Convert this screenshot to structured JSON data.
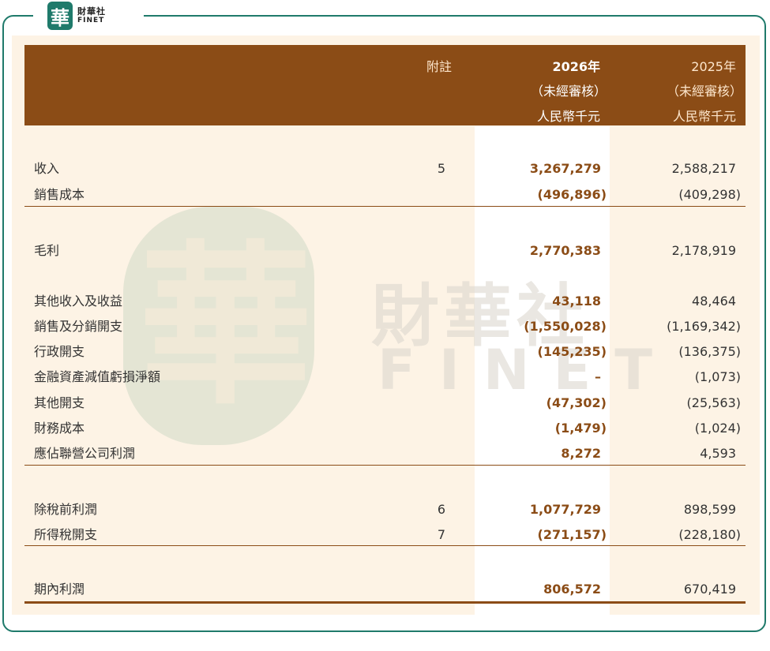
{
  "brand": {
    "name_cn": "財華社",
    "name_en": "FINET",
    "seal_char": "華"
  },
  "header": {
    "note_label": "附註",
    "current": {
      "year": "2026年",
      "audit": "（未經審核）",
      "unit": "人民幣千元"
    },
    "previous": {
      "year": "2025年",
      "audit": "（未經審核）",
      "unit": "人民幣千元"
    }
  },
  "rows": [
    {
      "label": "收入",
      "note": "5",
      "current": "3,267,279",
      "previous": "2,588,217"
    },
    {
      "label": "銷售成本",
      "note": "",
      "current": "(496,896)",
      "previous": "(409,298)"
    },
    {
      "label": "毛利",
      "note": "",
      "current": "2,770,383",
      "previous": "2,178,919"
    },
    {
      "label": "其他收入及收益",
      "note": "",
      "current": "43,118",
      "previous": "48,464"
    },
    {
      "label": "銷售及分銷開支",
      "note": "",
      "current": "(1,550,028)",
      "previous": "(1,169,342)"
    },
    {
      "label": "行政開支",
      "note": "",
      "current": "(145,235)",
      "previous": "(136,375)"
    },
    {
      "label": "金融資產減值虧損淨額",
      "note": "",
      "current": "–",
      "previous": "(1,073)"
    },
    {
      "label": "其他開支",
      "note": "",
      "current": "(47,302)",
      "previous": "(25,563)"
    },
    {
      "label": "財務成本",
      "note": "",
      "current": "(1,479)",
      "previous": "(1,024)"
    },
    {
      "label": "應佔聯營公司利潤",
      "note": "",
      "current": "8,272",
      "previous": "4,593"
    },
    {
      "label": "除稅前利潤",
      "note": "6",
      "current": "1,077,729",
      "previous": "898,599"
    },
    {
      "label": "所得稅開支",
      "note": "7",
      "current": "(271,157)",
      "previous": "(228,180)"
    },
    {
      "label": "期內利潤",
      "note": "",
      "current": "806,572",
      "previous": "670,419"
    }
  ],
  "watermark": {
    "cn": "財華社",
    "en": "FINET",
    "seal_char": "華"
  },
  "colors": {
    "header_band": "#8b4c16",
    "frame": "#1f7a6b",
    "panel": "#fdf3e5",
    "accent_text": "#8b4c16"
  }
}
